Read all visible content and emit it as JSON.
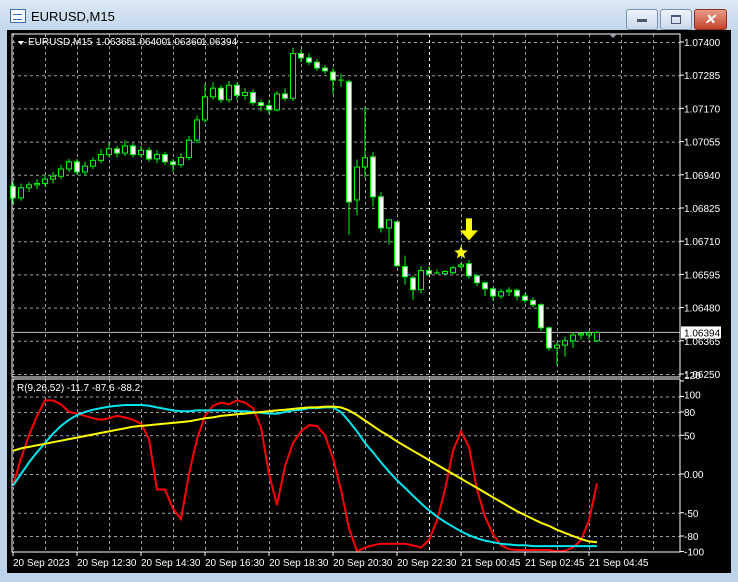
{
  "window": {
    "title": "EURUSD,M15",
    "minimize_icon": "minimize-icon",
    "maximize_icon": "maximize-icon",
    "close_icon": "close-icon"
  },
  "chart_header": {
    "symbol": "EURUSD,M15",
    "open": "1.06365",
    "high": "1.06400",
    "low": "1.06360",
    "close": "1.06394"
  },
  "colors": {
    "background": "#000000",
    "grid": "#9aa0a8",
    "candle_outline": "#00ff00",
    "bear_fill": "#ffffff",
    "bull_fill": "#000000",
    "red_line": "#ff0000",
    "cyan_line": "#00e5ee",
    "yellow_line": "#ffff00",
    "marker": "#ffff00"
  },
  "chart_data": [
    {
      "type": "candlestick",
      "title": "EURUSD,M15",
      "price_ticks": [
        "1.07400",
        "1.07285",
        "1.07170",
        "1.07055",
        "1.06940",
        "1.06825",
        "1.06710",
        "1.06595",
        "1.06480",
        "1.06365",
        "1.06250"
      ],
      "current_price": "1.06394",
      "ylim": [
        1.0625,
        1.074
      ],
      "time_labels": [
        "20 Sep 2023",
        "20 Sep 12:30",
        "20 Sep 14:30",
        "20 Sep 16:30",
        "20 Sep 18:30",
        "20 Sep 20:30",
        "20 Sep 22:30",
        "21 Sep 00:45",
        "21 Sep 02:45",
        "21 Sep 04:45"
      ],
      "ohlc": [
        [
          1.069,
          1.06915,
          1.0684,
          1.0686
        ],
        [
          1.0686,
          1.0691,
          1.0685,
          1.06895
        ],
        [
          1.06895,
          1.06915,
          1.0688,
          1.06905
        ],
        [
          1.06905,
          1.06925,
          1.0689,
          1.0691
        ],
        [
          1.0691,
          1.0694,
          1.069,
          1.06925
        ],
        [
          1.06925,
          1.0695,
          1.0691,
          1.06935
        ],
        [
          1.06935,
          1.06975,
          1.06925,
          1.0696
        ],
        [
          1.0696,
          1.06995,
          1.0695,
          1.06985
        ],
        [
          1.06985,
          1.06995,
          1.0694,
          1.0695
        ],
        [
          1.0695,
          1.06985,
          1.0694,
          1.0697
        ],
        [
          1.0697,
          1.07,
          1.0696,
          1.0699
        ],
        [
          1.0699,
          1.0703,
          1.0698,
          1.0701
        ],
        [
          1.0701,
          1.0705,
          1.07,
          1.0703
        ],
        [
          1.0703,
          1.0704,
          1.07,
          1.07015
        ],
        [
          1.07015,
          1.0706,
          1.07005,
          1.0704
        ],
        [
          1.0704,
          1.0705,
          1.07,
          1.0701
        ],
        [
          1.0701,
          1.0704,
          1.07,
          1.07025
        ],
        [
          1.07025,
          1.07035,
          1.06985,
          1.06995
        ],
        [
          1.06995,
          1.07025,
          1.0698,
          1.0701
        ],
        [
          1.0701,
          1.0702,
          1.06975,
          1.06985
        ],
        [
          1.06985,
          1.06995,
          1.0695,
          1.06975
        ],
        [
          1.06975,
          1.07015,
          1.06965,
          1.07
        ],
        [
          1.07,
          1.07075,
          1.0699,
          1.0706
        ],
        [
          1.0706,
          1.07145,
          1.0705,
          1.0713
        ],
        [
          1.0713,
          1.07255,
          1.0712,
          1.0721
        ],
        [
          1.0721,
          1.0726,
          1.072,
          1.0724
        ],
        [
          1.0724,
          1.0725,
          1.0719,
          1.072
        ],
        [
          1.072,
          1.07265,
          1.0719,
          1.0725
        ],
        [
          1.0725,
          1.0726,
          1.072,
          1.07215
        ],
        [
          1.07215,
          1.0724,
          1.072,
          1.07225
        ],
        [
          1.07225,
          1.07235,
          1.0718,
          1.0719
        ],
        [
          1.0719,
          1.072,
          1.0716,
          1.0718
        ],
        [
          1.0718,
          1.072,
          1.0715,
          1.07165
        ],
        [
          1.07165,
          1.0723,
          1.0716,
          1.0722
        ],
        [
          1.0722,
          1.0724,
          1.07195,
          1.07205
        ],
        [
          1.07205,
          1.0738,
          1.07195,
          1.0736
        ],
        [
          1.0736,
          1.07375,
          1.0733,
          1.07345
        ],
        [
          1.07345,
          1.0736,
          1.0732,
          1.0733
        ],
        [
          1.0733,
          1.0734,
          1.073,
          1.0731
        ],
        [
          1.0731,
          1.0732,
          1.0729,
          1.073
        ],
        [
          1.07296,
          1.0731,
          1.0722,
          1.07268
        ],
        [
          1.07268,
          1.0729,
          1.07245,
          1.07265
        ],
        [
          1.07262,
          1.0727,
          1.06732,
          1.06846
        ],
        [
          1.06853,
          1.06993,
          1.068,
          1.06967
        ],
        [
          1.06967,
          1.07175,
          1.0693,
          1.06999
        ],
        [
          1.07002,
          1.0702,
          1.0683,
          1.06864
        ],
        [
          1.06864,
          1.0688,
          1.0674,
          1.06756
        ],
        [
          1.06756,
          1.06784,
          1.06698,
          1.06784
        ],
        [
          1.06777,
          1.0678,
          1.0662,
          1.06625
        ],
        [
          1.06622,
          1.0666,
          1.0656,
          1.06587
        ],
        [
          1.06583,
          1.0659,
          1.06507,
          1.06542
        ],
        [
          1.06542,
          1.06625,
          1.0653,
          1.06608
        ],
        [
          1.06608,
          1.06625,
          1.0659,
          1.06597
        ],
        [
          1.066,
          1.06612,
          1.06595,
          1.066
        ],
        [
          1.06597,
          1.0661,
          1.06595,
          1.06605
        ],
        [
          1.06601,
          1.06625,
          1.06595,
          1.06618
        ],
        [
          1.06622,
          1.06635,
          1.06615,
          1.06628
        ],
        [
          1.06632,
          1.06645,
          1.0658,
          1.0659
        ],
        [
          1.0659,
          1.06595,
          1.06555,
          1.06566
        ],
        [
          1.06566,
          1.0657,
          1.0652,
          1.06545
        ],
        [
          1.06545,
          1.0655,
          1.06505,
          1.0652
        ],
        [
          1.0652,
          1.06545,
          1.0651,
          1.06535
        ],
        [
          1.06535,
          1.0655,
          1.0652,
          1.0654
        ],
        [
          1.0654,
          1.06545,
          1.06505,
          1.0652
        ],
        [
          1.0652,
          1.0653,
          1.06495,
          1.06505
        ],
        [
          1.06505,
          1.06515,
          1.0648,
          1.0649
        ],
        [
          1.0649,
          1.06495,
          1.064,
          1.0641
        ],
        [
          1.0641,
          1.06415,
          1.0633,
          1.0634
        ],
        [
          1.0634,
          1.0636,
          1.0628,
          1.0635
        ],
        [
          1.0635,
          1.0638,
          1.0631,
          1.06365
        ],
        [
          1.06365,
          1.06395,
          1.0634,
          1.06385
        ],
        [
          1.06385,
          1.06395,
          1.0637,
          1.0639
        ],
        [
          1.06385,
          1.064,
          1.0637,
          1.06392
        ],
        [
          1.06365,
          1.064,
          1.0636,
          1.06394
        ]
      ],
      "markers": [
        {
          "type": "star",
          "candle_index": 56,
          "price": 1.0667
        },
        {
          "type": "down-arrow",
          "candle_index": 57,
          "price": 1.0672
        }
      ]
    },
    {
      "type": "line",
      "title": "R(9,26,52) -11.7 -87.6 -88.2",
      "y_ticks": [
        "120",
        "100",
        "80",
        "50",
        "0.00",
        "-50",
        "-80",
        "-100"
      ],
      "ylim": [
        -100,
        120
      ],
      "series": [
        {
          "name": "R9",
          "color": "#ff0000",
          "values": [
            -15,
            20,
            50,
            75,
            95,
            95,
            90,
            80,
            78,
            75,
            72,
            70,
            72,
            75,
            73,
            70,
            65,
            45,
            -20,
            -20,
            -45,
            -58,
            0,
            45,
            75,
            88,
            92,
            90,
            95,
            92,
            85,
            60,
            0,
            -40,
            10,
            40,
            55,
            63,
            62,
            50,
            20,
            -20,
            -70,
            -100,
            -95,
            -92,
            -90,
            -90,
            -90,
            -90,
            -92,
            -95,
            -85,
            -60,
            -20,
            30,
            55,
            35,
            -20,
            -55,
            -78,
            -92,
            -97,
            -98,
            -98,
            -98,
            -98,
            -98,
            -100,
            -99,
            -95,
            -85,
            -60,
            -12
          ]
        },
        {
          "name": "R26",
          "color": "#00e5ee",
          "values": [
            -15,
            0,
            15,
            28,
            40,
            52,
            62,
            70,
            76,
            80,
            83,
            85,
            87,
            88,
            89,
            89,
            89,
            88,
            86,
            84,
            82,
            81,
            81,
            82,
            82,
            82,
            82,
            82,
            81,
            81,
            80,
            79,
            78,
            78,
            80,
            82,
            83,
            85,
            85,
            86,
            86,
            80,
            68,
            55,
            40,
            28,
            15,
            3,
            -8,
            -18,
            -28,
            -38,
            -47,
            -55,
            -62,
            -68,
            -74,
            -79,
            -83,
            -86,
            -88,
            -90,
            -91,
            -92,
            -92,
            -93,
            -93,
            -93,
            -93,
            -93,
            -93,
            -93,
            -93,
            -93
          ]
        },
        {
          "name": "R52",
          "color": "#ffff00",
          "values": [
            30,
            33,
            35,
            37,
            39,
            41,
            43,
            45,
            47,
            49,
            51,
            53,
            55,
            57,
            59,
            61,
            62,
            63,
            64,
            65,
            66,
            67,
            68,
            70,
            72,
            73,
            75,
            76,
            77,
            78,
            79,
            80,
            81,
            82,
            83,
            84,
            85,
            86,
            86,
            87,
            87,
            86,
            82,
            76,
            69,
            62,
            55,
            49,
            42,
            36,
            30,
            24,
            18,
            12,
            6,
            0,
            -6,
            -12,
            -18,
            -24,
            -30,
            -36,
            -42,
            -48,
            -53,
            -58,
            -63,
            -67,
            -72,
            -76,
            -80,
            -84,
            -87,
            -88
          ]
        }
      ]
    }
  ]
}
